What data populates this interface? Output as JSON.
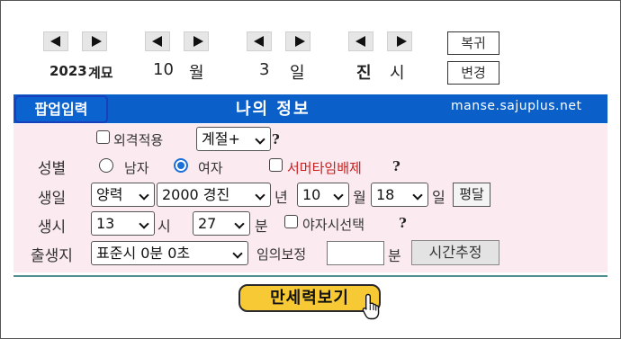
{
  "date_controls": {
    "year": "2023",
    "year_ganji": "계묘",
    "month_value": "10",
    "month_unit": "월",
    "day_value": "3",
    "day_unit": "일",
    "hour_value": "진",
    "hour_unit": "시",
    "restore_label": "복귀",
    "change_label": "변경"
  },
  "header": {
    "popup_label": "팝업입력",
    "title": "나의 정보",
    "site": "manse.sajuplus.net"
  },
  "options": {
    "external_apply_label": "외격적용",
    "season_select": "계절+",
    "help": "?"
  },
  "gender": {
    "label": "성별",
    "male": "남자",
    "female": "여자",
    "summer_time_label": "서머타임배제",
    "help": "?"
  },
  "birth_date": {
    "label": "생일",
    "calendar": "양력",
    "year": "2000 경진",
    "year_unit": "년",
    "month": "10",
    "month_unit": "월",
    "day": "18",
    "day_unit": "일",
    "leap_button": "평달"
  },
  "birth_time": {
    "label": "생시",
    "hour": "13",
    "hour_unit": "시",
    "minute": "27",
    "minute_unit": "분",
    "night_select_label": "야자시선택",
    "help": "?"
  },
  "birthplace": {
    "label": "출생지",
    "timezone": "표준시 0분 0초",
    "custom_label": "임의보정",
    "custom_value": "",
    "minute_unit": "분",
    "estimate_button": "시간추정"
  },
  "submit_label": "만세력보기"
}
